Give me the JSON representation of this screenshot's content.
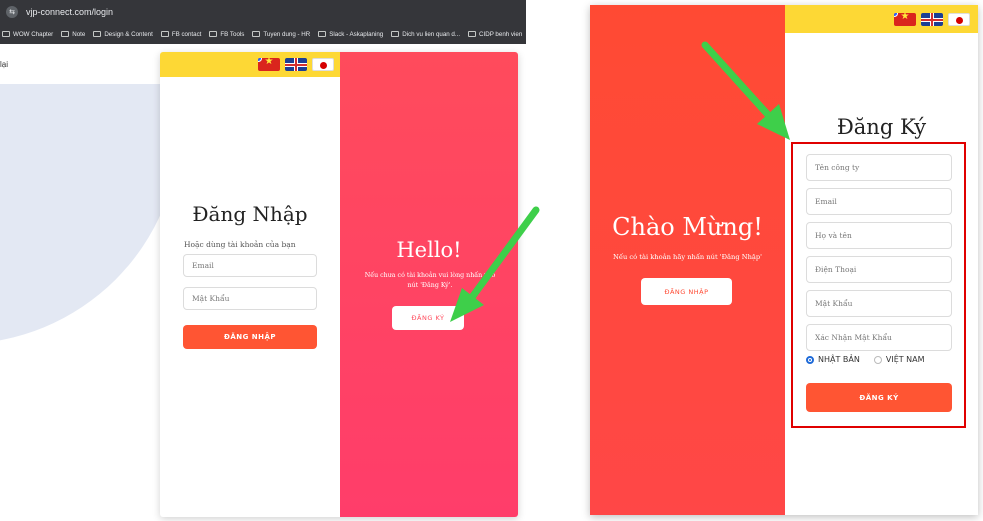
{
  "left": {
    "browser": {
      "url": "vjp-connect.com/login",
      "bookmarks": [
        "WOW Chapter",
        "Note",
        "Design & Content",
        "FB contact",
        "FB Tools",
        "Tuyen dung - HR",
        "Slack - Askaplaning",
        "Dich vu lien quan d...",
        "CIDP benh vien"
      ]
    },
    "page_corner_text": "lại",
    "login": {
      "title": "Đăng Nhập",
      "subtitle": "Hoặc dùng tài khoản của bạn",
      "email_placeholder": "Email",
      "password_placeholder": "Mật Khẩu",
      "login_button": "ĐĂNG NHẬP"
    },
    "hello": {
      "title": "Hello!",
      "subtitle": "Nếu chưa có tài khoản vui lòng nhấn vào nút 'Đăng Ký'.",
      "register_button": "ĐĂNG KÝ"
    }
  },
  "right": {
    "welcome": {
      "title": "Chào Mừng!",
      "subtitle": "Nếu có tài khoản hãy nhấn nút 'Đăng Nhập'",
      "login_button": "ĐĂNG NHẬP"
    },
    "register": {
      "title": "Đăng Ký",
      "company_placeholder": "Tên công ty",
      "email_placeholder": "Email",
      "fullname_placeholder": "Họ và tên",
      "phone_placeholder": "Điện Thoại",
      "password_placeholder": "Mật Khẩu",
      "confirm_placeholder": "Xác Nhận Mật Khẩu",
      "radio_japan": "NHẬT BẢN",
      "radio_vietnam": "VIỆT NAM",
      "register_button": "ĐĂNG KÝ"
    }
  },
  "colors": {
    "accent_red": "#ff5533",
    "panel_pink": "#ff4b5c",
    "topbar_yellow": "#fdd835",
    "arrow_green": "#3ecf4a",
    "highlight_red": "#e00000"
  }
}
